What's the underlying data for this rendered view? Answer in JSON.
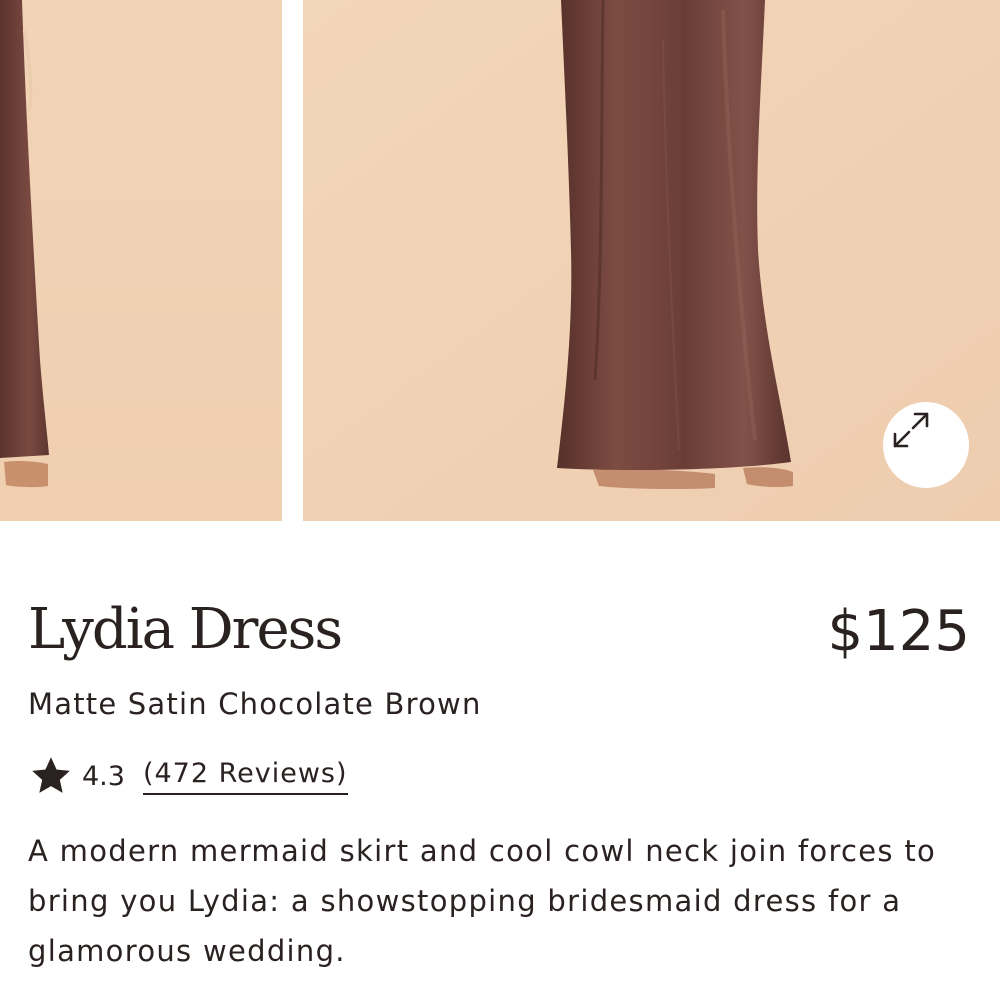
{
  "gallery": {
    "images": [
      {
        "alt": "Lydia Dress side view"
      },
      {
        "alt": "Lydia Dress front view"
      }
    ],
    "expand_icon": "expand-arrows-icon",
    "background_color": "#f0d0b2",
    "fabric_color": "#6b3f37"
  },
  "product": {
    "title": "Lydia Dress",
    "price": "$125",
    "variant": "Matte Satin Chocolate Brown",
    "rating": "4.3",
    "rating_icon": "star-icon",
    "reviews_label": "(472 Reviews)",
    "description": "A modern mermaid skirt and cool cowl neck join forces to bring you Lydia: a showstopping bridesmaid dress for a glamorous wedding."
  }
}
